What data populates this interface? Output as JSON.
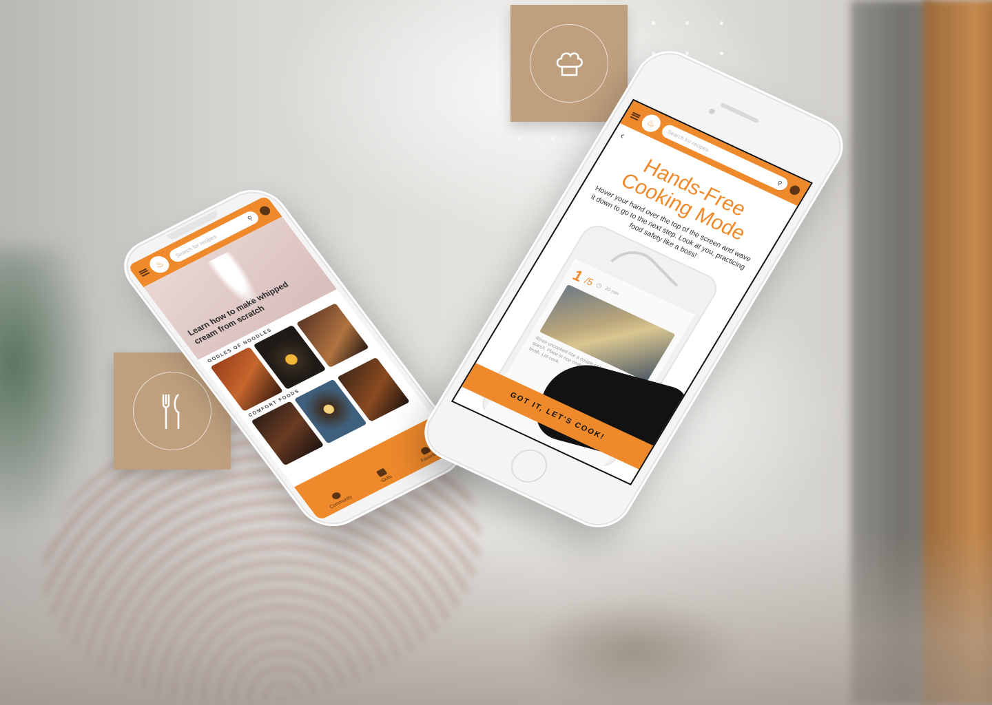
{
  "icons": {
    "chef": "chef-hat-icon",
    "utensils": "fork-knife-icon",
    "menu": "hamburger-menu-icon",
    "search": "search-icon",
    "user": "user-account-icon",
    "back": "chevron-left-icon"
  },
  "colors": {
    "accent": "#ef8a2c",
    "badge": "#bfa07e",
    "nav_text": "#5a3414"
  },
  "left_phone": {
    "search_placeholder": "Search for recipes",
    "hero_title": "Learn how to make whipped cream from scratch",
    "section1": "OODLES OF NOODLES",
    "section2": "COMFORT FOODS",
    "nav": [
      {
        "label": "Community"
      },
      {
        "label": "Skills"
      },
      {
        "label": "Favorites"
      }
    ]
  },
  "right_phone": {
    "search_placeholder": "Search for recipes",
    "title": "Hands-Free Cooking Mode",
    "body": "Hover your hand over the top of the screen and wave it down to go to the next step. Look at you, practicing food safety like a boss!",
    "step_current": "1",
    "step_total": "/5",
    "step_meta": "20 min",
    "step_text": "Rinse uncooked rice a couple of times to remove starch. Place in rice cooker and add water and chicken broth. Let cook.",
    "cta_label": "GOT IT, LET'S COOK!"
  }
}
